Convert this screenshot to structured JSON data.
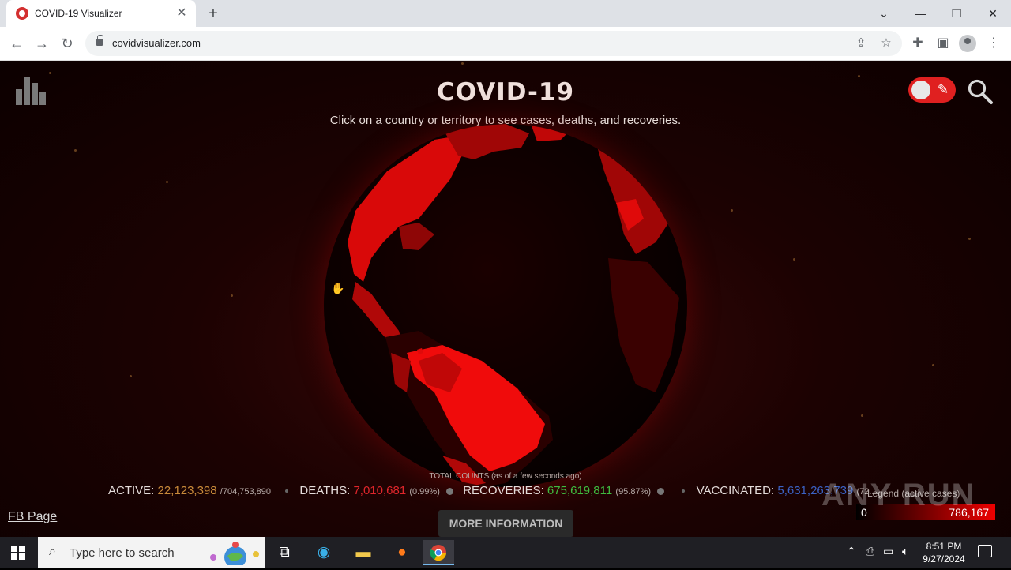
{
  "browser": {
    "tab_title": "COVID-19 Visualizer",
    "url": "covidvisualizer.com"
  },
  "page": {
    "title": "COVID-19",
    "subtitle": "Click on a country or territory to see cases, deaths, and recoveries.",
    "total_counts_label": "TOTAL COUNTS (as of a few seconds ago)",
    "active_label": "ACTIVE:",
    "active_value": "22,123,398",
    "active_total": "/704,753,890",
    "deaths_label": "DEATHS:",
    "deaths_value": "7,010,681",
    "deaths_pct": "(0.99%)",
    "recoveries_label": "RECOVERIES:",
    "recoveries_value": "675,619,811",
    "recoveries_pct": "(95.87%)",
    "vaccinated_label": "VACCINATED:",
    "vaccinated_value": "5,631,263,739",
    "vaccinated_pct": "(72...",
    "legend_label": "Legend (active cases)",
    "legend_min": "0",
    "legend_max": "786,167",
    "fb_link": "FB Page",
    "more_info": "MORE INFORMATION",
    "watermark": "ANY RUN"
  },
  "colors": {
    "active": "#c88a3a",
    "deaths": "#e0262b",
    "recoveries": "#3fbb3f",
    "vaccinated": "#3b62c4",
    "toggle": "#e02020"
  },
  "taskbar": {
    "search_placeholder": "Type here to search",
    "time": "8:51 PM",
    "date": "9/27/2024"
  }
}
